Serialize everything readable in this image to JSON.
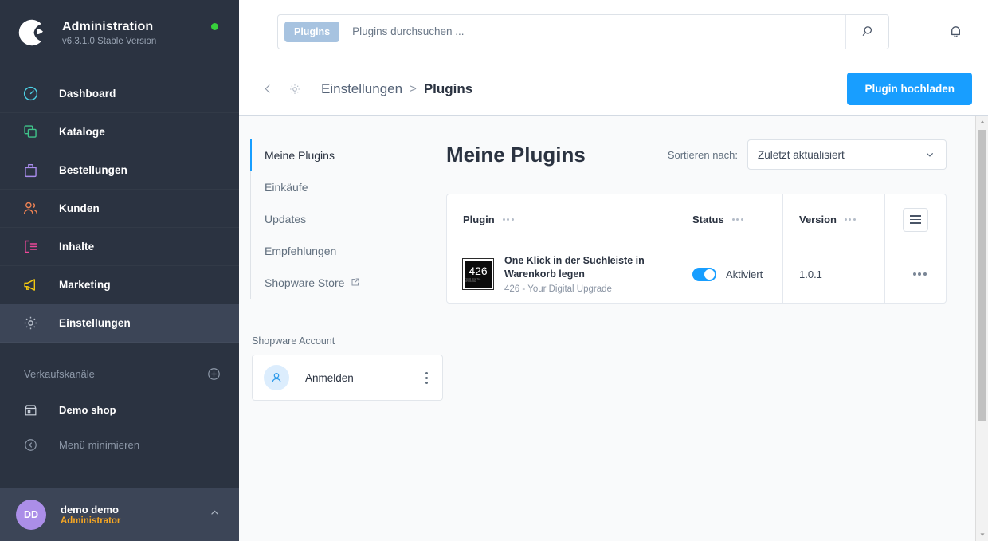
{
  "sidebar": {
    "brand": {
      "title": "Administration",
      "version": "v6.3.1.0 Stable Version",
      "logo_icon": "shopware-logo-icon",
      "status_dot_color": "#37d13b"
    },
    "items": [
      {
        "label": "Dashboard",
        "icon": "speedometer-icon",
        "color": "#4dd2e6",
        "active": false
      },
      {
        "label": "Kataloge",
        "icon": "copy-stack-icon",
        "color": "#3fc48a",
        "active": false
      },
      {
        "label": "Bestellungen",
        "icon": "shopping-bag-icon",
        "color": "#a98ced",
        "active": false
      },
      {
        "label": "Kunden",
        "icon": "users-icon",
        "color": "#ef8354",
        "active": false
      },
      {
        "label": "Inhalte",
        "icon": "content-list-icon",
        "color": "#ec4899",
        "active": false
      },
      {
        "label": "Marketing",
        "icon": "megaphone-icon",
        "color": "#f2c811",
        "active": false
      },
      {
        "label": "Einstellungen",
        "icon": "gear-icon",
        "color": "#b5bdc9",
        "active": true
      }
    ],
    "sales_channels": {
      "label": "Verkaufskanäle",
      "add_icon": "plus-circle-icon",
      "items": [
        {
          "label": "Demo shop",
          "icon": "storefront-icon"
        }
      ]
    },
    "minimize": {
      "label": "Menü minimieren",
      "icon": "chevron-left-circle-icon"
    },
    "user": {
      "initials": "DD",
      "name": "demo demo",
      "role": "Administrator",
      "caret_icon": "chevron-up-icon"
    }
  },
  "topbar": {
    "search": {
      "chip_label": "Plugins",
      "placeholder": "Plugins durchsuchen ...",
      "value": "",
      "search_icon": "search-icon"
    },
    "bell_icon": "bell-icon"
  },
  "breadcrumb": {
    "back_icon": "chevron-left-icon",
    "settings_icon": "gear-icon",
    "parent": "Einstellungen",
    "separator": ">",
    "current": "Plugins",
    "upload_button": "Plugin hochladen",
    "accent_color": "#189eff"
  },
  "side_nav": {
    "items": [
      {
        "label": "Meine Plugins",
        "active": true,
        "external": false
      },
      {
        "label": "Einkäufe",
        "active": false,
        "external": false
      },
      {
        "label": "Updates",
        "active": false,
        "external": false
      },
      {
        "label": "Empfehlungen",
        "active": false,
        "external": false
      },
      {
        "label": "Shopware Store",
        "active": false,
        "external": true,
        "external_icon": "external-link-icon"
      }
    ],
    "account": {
      "label": "Shopware Account",
      "action": "Anmelden",
      "avatar_icon": "user-icon",
      "menu_icon": "kebab-vertical-icon"
    }
  },
  "main": {
    "title": "Meine Plugins",
    "sort": {
      "label": "Sortieren nach:",
      "value": "Zuletzt aktualisiert",
      "caret_icon": "chevron-down-icon"
    },
    "table": {
      "columns": [
        {
          "label": "Plugin",
          "menu_icon": "dots-horizontal-icon"
        },
        {
          "label": "Status",
          "menu_icon": "dots-horizontal-icon"
        },
        {
          "label": "Version",
          "menu_icon": "dots-horizontal-icon"
        }
      ],
      "settings_icon": "table-settings-icon",
      "rows": [
        {
          "icon_text": "426",
          "icon_subtext": "YOUR DIGITAL UPGRADE",
          "name": "One Klick in der Suchleiste in Warenkorb legen",
          "vendor": "426 - Your Digital Upgrade",
          "status": "Aktiviert",
          "status_on": true,
          "version": "1.0.1",
          "actions_icon": "dots-horizontal-icon"
        }
      ]
    }
  },
  "scrollbar": {
    "up_icon": "triangle-up-icon",
    "down_icon": "triangle-down-icon"
  }
}
